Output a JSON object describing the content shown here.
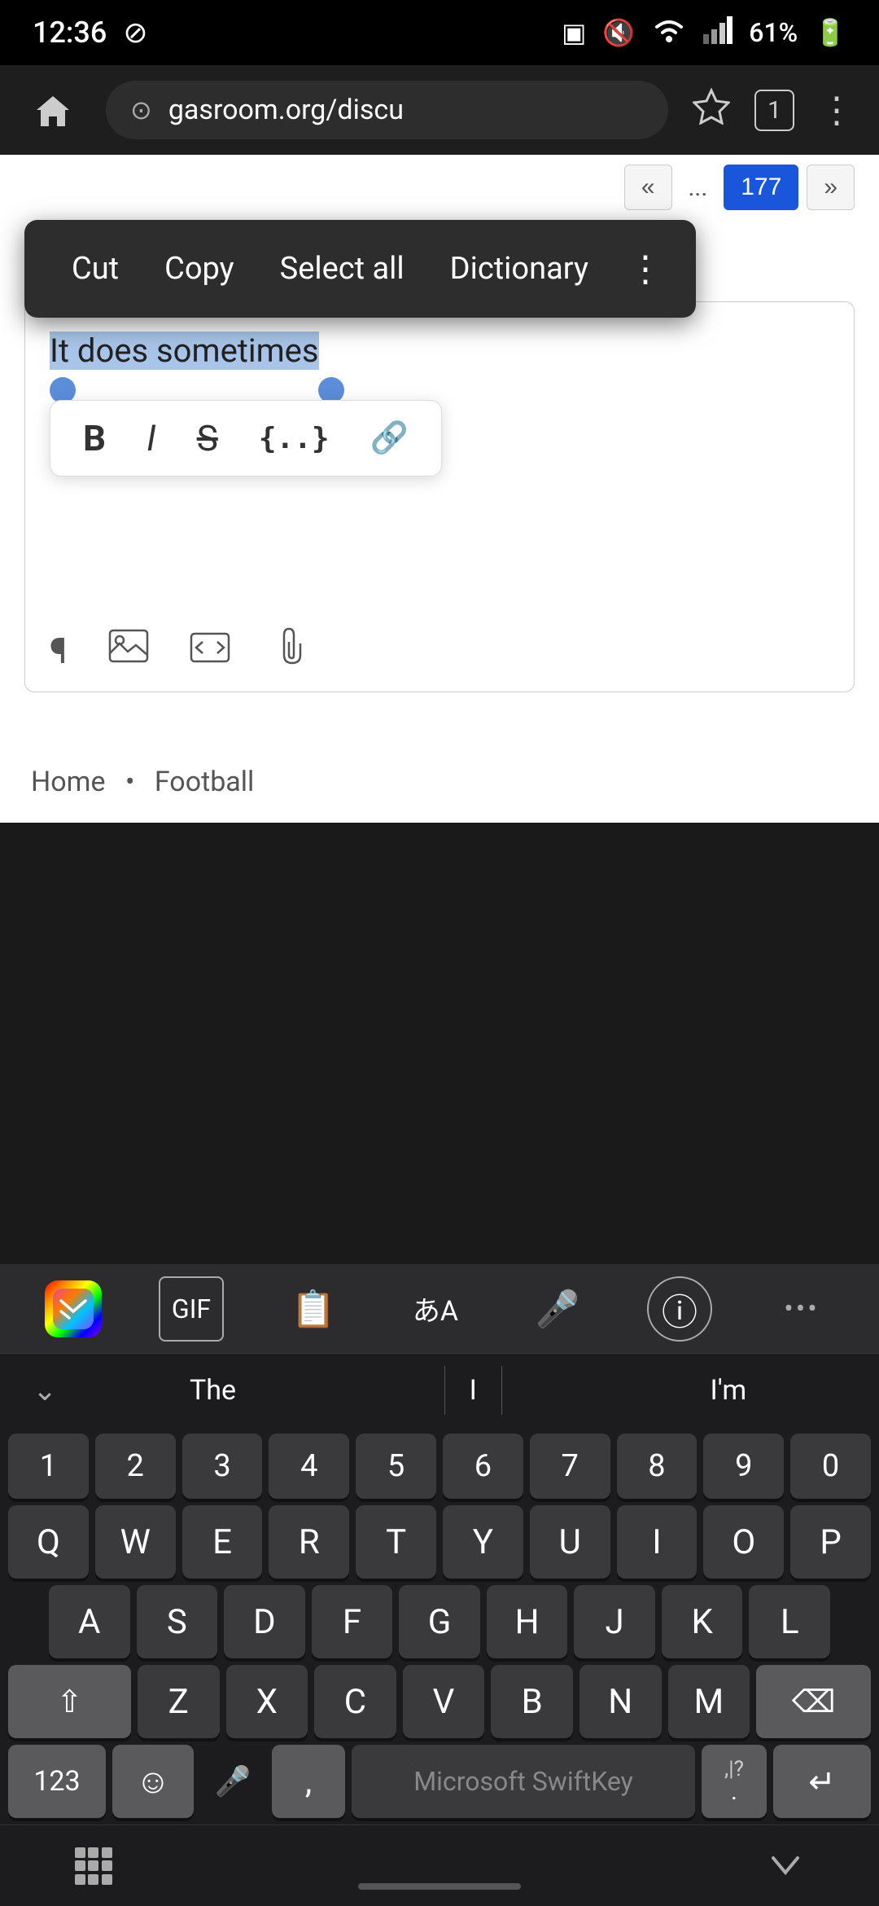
{
  "status": {
    "time": "12:36",
    "battery": "61%",
    "signal_bars": "▂▄▆",
    "wifi": "wifi"
  },
  "browser": {
    "url": "gasroom.org/discu",
    "tab_count": "1"
  },
  "pagination": {
    "first": "«",
    "ellipsis": "...",
    "current": "177",
    "last": "»"
  },
  "context_menu": {
    "cut": "Cut",
    "copy": "Copy",
    "select_all": "Select all",
    "dictionary": "Dictionary",
    "more": "⋮"
  },
  "editor": {
    "text_before": "It does sometimes",
    "placeholder": ""
  },
  "format_toolbar": {
    "bold": "B",
    "italic": "I",
    "strikethrough": "S",
    "code": "{..}",
    "link": "🔗"
  },
  "breadcrumb": {
    "home": "Home",
    "separator": "•",
    "section": "Football"
  },
  "keyboard_toolbar": {
    "gif_label": "GIF",
    "clipboard_icon": "📋",
    "lang_icon": "あA",
    "mic_icon": "🎤",
    "info_icon": "ⓘ",
    "more_icon": "•••"
  },
  "suggestions": {
    "left": "The",
    "center": "I",
    "right": "I'm"
  },
  "number_row": [
    "1",
    "2",
    "3",
    "4",
    "5",
    "6",
    "7",
    "8",
    "9",
    "0"
  ],
  "row1": [
    "Q",
    "W",
    "E",
    "R",
    "T",
    "Y",
    "U",
    "I",
    "O",
    "P"
  ],
  "row2": [
    "A",
    "S",
    "D",
    "F",
    "G",
    "H",
    "J",
    "K",
    "L"
  ],
  "row3": [
    "Z",
    "X",
    "C",
    "V",
    "B",
    "N",
    "M"
  ],
  "keyboard_bottom": {
    "num_label": "123",
    "space_label": "Microsoft SwiftKey",
    "punct_top": ",|?",
    "punct_bottom": ".",
    "enter_icon": "↵"
  }
}
